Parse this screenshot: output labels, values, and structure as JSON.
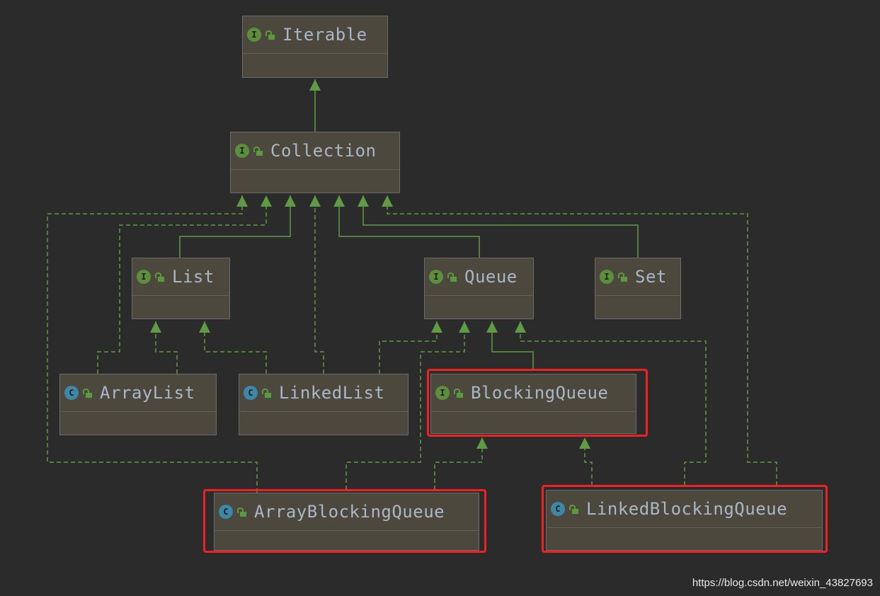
{
  "diagram": {
    "nodes": [
      {
        "id": "iterable",
        "name": "Iterable",
        "kind": "interface",
        "badge": "I"
      },
      {
        "id": "collection",
        "name": "Collection",
        "kind": "interface",
        "badge": "I"
      },
      {
        "id": "list",
        "name": "List",
        "kind": "interface",
        "badge": "I"
      },
      {
        "id": "queue",
        "name": "Queue",
        "kind": "interface",
        "badge": "I"
      },
      {
        "id": "set",
        "name": "Set",
        "kind": "interface",
        "badge": "I"
      },
      {
        "id": "arraylist",
        "name": "ArrayList",
        "kind": "class",
        "badge": "C"
      },
      {
        "id": "linkedlist",
        "name": "LinkedList",
        "kind": "class",
        "badge": "C"
      },
      {
        "id": "blockingqueue",
        "name": "BlockingQueue",
        "kind": "interface",
        "badge": "I",
        "highlighted": true
      },
      {
        "id": "arrayblockingqueue",
        "name": "ArrayBlockingQueue",
        "kind": "class",
        "badge": "C",
        "highlighted": true
      },
      {
        "id": "linkedblockingqueue",
        "name": "LinkedBlockingQueue",
        "kind": "class",
        "badge": "C",
        "highlighted": true
      }
    ],
    "edges": [
      {
        "from": "collection",
        "to": "iterable",
        "type": "extends"
      },
      {
        "from": "arrayblockingqueue",
        "to": "collection",
        "type": "implements"
      },
      {
        "from": "arraylist",
        "to": "collection",
        "type": "implements"
      },
      {
        "from": "list",
        "to": "collection",
        "type": "extends"
      },
      {
        "from": "linkedlist",
        "to": "collection",
        "type": "implements"
      },
      {
        "from": "queue",
        "to": "collection",
        "type": "extends"
      },
      {
        "from": "set",
        "to": "collection",
        "type": "extends"
      },
      {
        "from": "linkedblockingqueue",
        "to": "collection",
        "type": "implements"
      },
      {
        "from": "arraylist",
        "to": "list",
        "type": "implements"
      },
      {
        "from": "linkedlist",
        "to": "list",
        "type": "implements"
      },
      {
        "from": "linkedlist",
        "to": "queue",
        "type": "implements"
      },
      {
        "from": "arrayblockingqueue",
        "to": "queue",
        "type": "implements"
      },
      {
        "from": "blockingqueue",
        "to": "queue",
        "type": "extends"
      },
      {
        "from": "linkedblockingqueue",
        "to": "queue",
        "type": "implements"
      },
      {
        "from": "arrayblockingqueue",
        "to": "blockingqueue",
        "type": "implements"
      },
      {
        "from": "linkedblockingqueue",
        "to": "blockingqueue",
        "type": "implements"
      }
    ],
    "colors": {
      "background": "#2b2b2b",
      "node": "#4d483d",
      "edge": "#5f9a45",
      "text": "#a9b7c6",
      "highlight": "#ee2222"
    }
  },
  "watermark": "https://blog.csdn.net/weixin_43827693"
}
